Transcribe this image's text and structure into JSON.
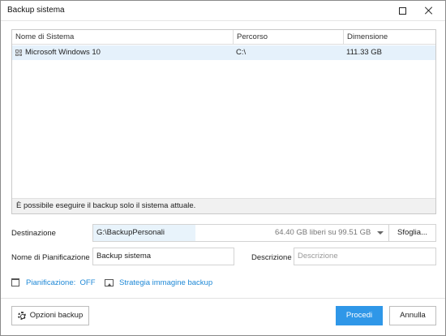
{
  "window": {
    "title": "Backup sistema"
  },
  "table": {
    "columns": [
      "Nome di Sistema",
      "Percorso",
      "Dimensione"
    ],
    "rows": [
      {
        "name": "Microsoft Windows 10",
        "path": "C:\\",
        "size": "111.33 GB",
        "icon": "windows-icon"
      }
    ],
    "footer_note": "È possibile eseguire il backup solo il sistema attuale."
  },
  "form": {
    "destination_label": "Destinazione",
    "destination_value": "G:\\BackupPersonali",
    "destination_free": "64.40 GB liberi su 99.51 GB",
    "browse_label": "Sfoglia...",
    "schedule_name_label": "Nome di Pianificazione",
    "schedule_name_value": "Backup sistema",
    "description_label": "Descrizione",
    "description_placeholder": "Descrizione"
  },
  "links": {
    "schedule": "Pianificazione:  OFF",
    "strategy": "Strategia immagine backup"
  },
  "buttons": {
    "options": "Opzioni backup",
    "proceed": "Procedi",
    "cancel": "Annulla"
  },
  "colors": {
    "accent": "#2f97e8",
    "link": "#1e88d6",
    "selection": "#e5f1fb"
  }
}
